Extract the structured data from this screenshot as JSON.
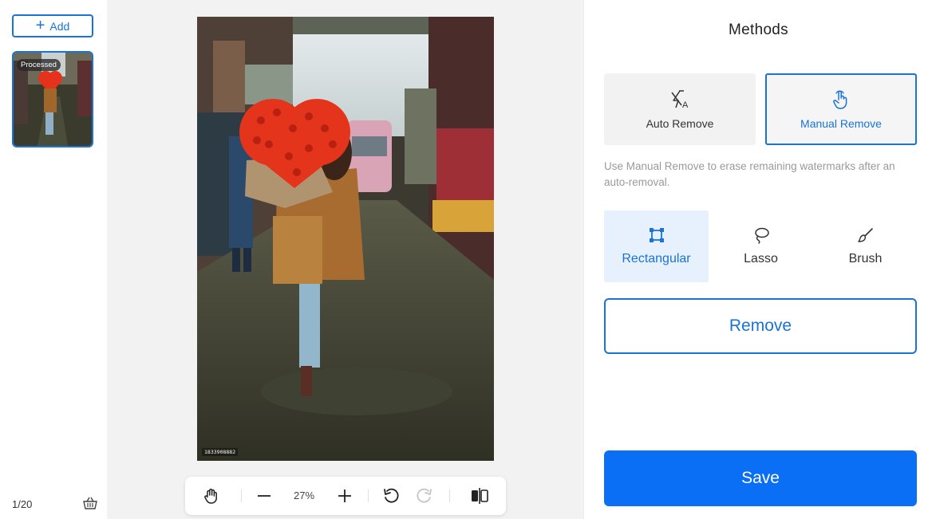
{
  "sidebar": {
    "add_label": "Add",
    "thumbnail_badge": "Processed",
    "counter": "1/20"
  },
  "canvas": {
    "watermark_text": "1833908882",
    "zoom_level": "27%"
  },
  "panel": {
    "title": "Methods",
    "methods": [
      {
        "label": "Auto Remove",
        "selected": false,
        "icon": "auto-remove-icon"
      },
      {
        "label": "Manual Remove",
        "selected": true,
        "icon": "hand-pointer-icon"
      }
    ],
    "hint": "Use Manual Remove to erase remaining watermarks after an auto-removal.",
    "tools": [
      {
        "label": "Rectangular",
        "selected": true,
        "icon": "rectangle-select-icon"
      },
      {
        "label": "Lasso",
        "selected": false,
        "icon": "lasso-icon"
      },
      {
        "label": "Brush",
        "selected": false,
        "icon": "brush-icon"
      }
    ],
    "remove_label": "Remove",
    "save_label": "Save"
  },
  "colors": {
    "accent": "#1a73d6",
    "save_bg": "#0a6ff5",
    "active_tool_bg": "#e6f1fd",
    "canvas_bg": "#f2f2f2"
  }
}
